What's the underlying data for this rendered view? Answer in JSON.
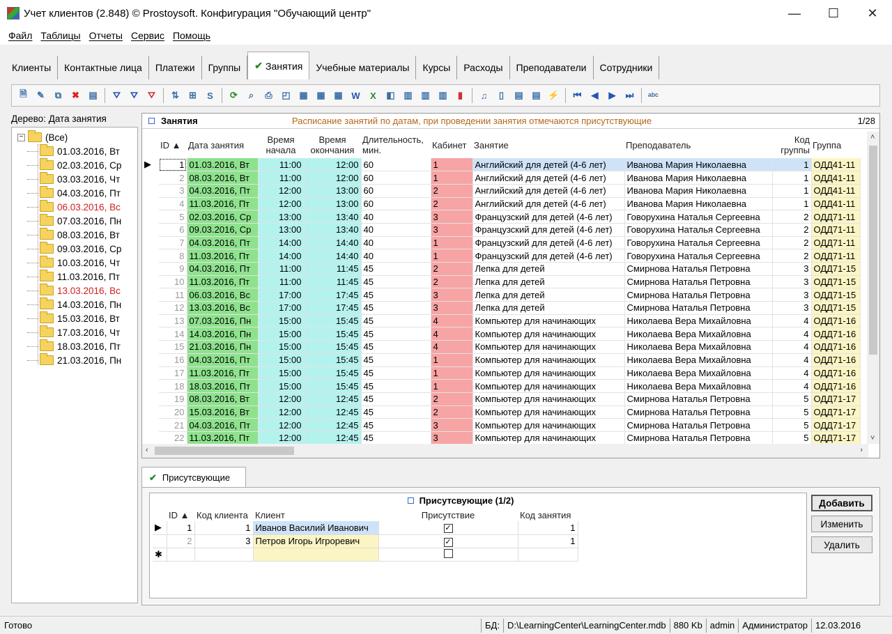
{
  "window": {
    "title": "Учет клиентов (2.848) © Prostoysoft. Конфигурация \"Обучающий центр\"",
    "minimize": "—",
    "maximize": "☐",
    "close": "✕"
  },
  "menu": [
    "Файл",
    "Таблицы",
    "Отчеты",
    "Сервис",
    "Помощь"
  ],
  "tabs": [
    {
      "label": "Клиенты"
    },
    {
      "label": "Контактные лица"
    },
    {
      "label": "Платежи"
    },
    {
      "label": "Группы"
    },
    {
      "label": "Занятия",
      "active": true
    },
    {
      "label": "Учебные материалы"
    },
    {
      "label": "Курсы"
    },
    {
      "label": "Расходы"
    },
    {
      "label": "Преподаватели"
    },
    {
      "label": "Сотрудники"
    }
  ],
  "tree": {
    "label": "Дерево: Дата занятия",
    "root": "(Все)",
    "items": [
      {
        "label": "01.03.2016, Вт"
      },
      {
        "label": "02.03.2016, Ср"
      },
      {
        "label": "03.03.2016, Чт"
      },
      {
        "label": "04.03.2016, Пт"
      },
      {
        "label": "06.03.2016, Вс",
        "weekend": true
      },
      {
        "label": "07.03.2016, Пн"
      },
      {
        "label": "08.03.2016, Вт"
      },
      {
        "label": "09.03.2016, Ср"
      },
      {
        "label": "10.03.2016, Чт"
      },
      {
        "label": "11.03.2016, Пт"
      },
      {
        "label": "13.03.2016, Вс",
        "weekend": true
      },
      {
        "label": "14.03.2016, Пн"
      },
      {
        "label": "15.03.2016, Вт"
      },
      {
        "label": "17.03.2016, Чт"
      },
      {
        "label": "18.03.2016, Пт"
      },
      {
        "label": "21.03.2016, Пн"
      }
    ]
  },
  "grid": {
    "title": "Занятия",
    "description": "Расписание занятий по датам, при проведении занятия отмечаются присутствующие",
    "count": "1/28",
    "columns": [
      "ID ▲",
      "Дата занятия",
      "Время начала",
      "Время окончания",
      "Длительность, мин.",
      "Кабинет",
      "Занятие",
      "Преподаватель",
      "Код группы",
      "Группа"
    ],
    "rows": [
      [
        "1",
        "01.03.2016, Вт",
        "11:00",
        "12:00",
        "60",
        "1",
        "Английский для детей (4-6 лет)",
        "Иванова Мария Николаевна",
        "1",
        "ОДД41-11"
      ],
      [
        "2",
        "08.03.2016, Вт",
        "11:00",
        "12:00",
        "60",
        "1",
        "Английский для детей (4-6 лет)",
        "Иванова Мария Николаевна",
        "1",
        "ОДД41-11"
      ],
      [
        "3",
        "04.03.2016, Пт",
        "12:00",
        "13:00",
        "60",
        "2",
        "Английский для детей (4-6 лет)",
        "Иванова Мария Николаевна",
        "1",
        "ОДД41-11"
      ],
      [
        "4",
        "11.03.2016, Пт",
        "12:00",
        "13:00",
        "60",
        "2",
        "Английский для детей (4-6 лет)",
        "Иванова Мария Николаевна",
        "1",
        "ОДД41-11"
      ],
      [
        "5",
        "02.03.2016, Ср",
        "13:00",
        "13:40",
        "40",
        "3",
        "Французский для детей (4-6 лет)",
        "Говорухина Наталья Сергеевна",
        "2",
        "ОДД71-11"
      ],
      [
        "6",
        "09.03.2016, Ср",
        "13:00",
        "13:40",
        "40",
        "3",
        "Французский для детей (4-6 лет)",
        "Говорухина Наталья Сергеевна",
        "2",
        "ОДД71-11"
      ],
      [
        "7",
        "04.03.2016, Пт",
        "14:00",
        "14:40",
        "40",
        "1",
        "Французский для детей (4-6 лет)",
        "Говорухина Наталья Сергеевна",
        "2",
        "ОДД71-11"
      ],
      [
        "8",
        "11.03.2016, Пт",
        "14:00",
        "14:40",
        "40",
        "1",
        "Французский для детей (4-6 лет)",
        "Говорухина Наталья Сергеевна",
        "2",
        "ОДД71-11"
      ],
      [
        "9",
        "04.03.2016, Пт",
        "11:00",
        "11:45",
        "45",
        "2",
        "Лепка для детей",
        "Смирнова Наталья Петровна",
        "3",
        "ОДД71-15"
      ],
      [
        "10",
        "11.03.2016, Пт",
        "11:00",
        "11:45",
        "45",
        "2",
        "Лепка для детей",
        "Смирнова Наталья Петровна",
        "3",
        "ОДД71-15"
      ],
      [
        "11",
        "06.03.2016, Вс",
        "17:00",
        "17:45",
        "45",
        "3",
        "Лепка для детей",
        "Смирнова Наталья Петровна",
        "3",
        "ОДД71-15"
      ],
      [
        "12",
        "13.03.2016, Вс",
        "17:00",
        "17:45",
        "45",
        "3",
        "Лепка для детей",
        "Смирнова Наталья Петровна",
        "3",
        "ОДД71-15"
      ],
      [
        "13",
        "07.03.2016, Пн",
        "15:00",
        "15:45",
        "45",
        "4",
        "Компьютер для начинающих",
        "Николаева Вера Михайловна",
        "4",
        "ОДД71-16"
      ],
      [
        "14",
        "14.03.2016, Пн",
        "15:00",
        "15:45",
        "45",
        "4",
        "Компьютер для начинающих",
        "Николаева Вера Михайловна",
        "4",
        "ОДД71-16"
      ],
      [
        "15",
        "21.03.2016, Пн",
        "15:00",
        "15:45",
        "45",
        "4",
        "Компьютер для начинающих",
        "Николаева Вера Михайловна",
        "4",
        "ОДД71-16"
      ],
      [
        "16",
        "04.03.2016, Пт",
        "15:00",
        "15:45",
        "45",
        "1",
        "Компьютер для начинающих",
        "Николаева Вера Михайловна",
        "4",
        "ОДД71-16"
      ],
      [
        "17",
        "11.03.2016, Пт",
        "15:00",
        "15:45",
        "45",
        "1",
        "Компьютер для начинающих",
        "Николаева Вера Михайловна",
        "4",
        "ОДД71-16"
      ],
      [
        "18",
        "18.03.2016, Пт",
        "15:00",
        "15:45",
        "45",
        "1",
        "Компьютер для начинающих",
        "Николаева Вера Михайловна",
        "4",
        "ОДД71-16"
      ],
      [
        "19",
        "08.03.2016, Вт",
        "12:00",
        "12:45",
        "45",
        "2",
        "Компьютер для начинающих",
        "Смирнова Наталья Петровна",
        "5",
        "ОДД71-17"
      ],
      [
        "20",
        "15.03.2016, Вт",
        "12:00",
        "12:45",
        "45",
        "2",
        "Компьютер для начинающих",
        "Смирнова Наталья Петровна",
        "5",
        "ОДД71-17"
      ],
      [
        "21",
        "04.03.2016, Пт",
        "12:00",
        "12:45",
        "45",
        "3",
        "Компьютер для начинающих",
        "Смирнова Наталья Петровна",
        "5",
        "ОДД71-17"
      ],
      [
        "22",
        "11.03.2016, Пт",
        "12:00",
        "12:45",
        "45",
        "3",
        "Компьютер для начинающих",
        "Смирнова Наталья Петровна",
        "5",
        "ОДД71-17"
      ]
    ]
  },
  "sub_tab": "Присутсвующие",
  "sub_grid": {
    "title": "Присутсвующие (1/2)",
    "columns": [
      "ID ▲",
      "Код клиента",
      "Клиент",
      "Присутствие",
      "Код занятия"
    ],
    "rows": [
      [
        "1",
        "1",
        "Иванов Василий Иванович",
        "✓",
        "1"
      ],
      [
        "2",
        "3",
        "Петров Игорь Игроревич",
        "✓",
        "1"
      ]
    ],
    "new_row_marker": "✱"
  },
  "buttons": {
    "add": "Добавить",
    "edit": "Изменить",
    "delete": "Удалить"
  },
  "status": {
    "text": "Готово",
    "db_label": "БД:",
    "db_path": "D:\\LearningCenter\\LearningCenter.mdb",
    "size": "880 Kb",
    "user": "admin",
    "role": "Администратор",
    "date": "12.03.2016"
  },
  "toolbar_icons": [
    "new-record-icon",
    "edit-icon",
    "copy-icon",
    "delete-icon",
    "card-icon",
    "filter-icon",
    "filter-edit-icon",
    "filter-clear-icon",
    "sort-icon",
    "tree-icon",
    "sql-icon",
    "refresh-icon",
    "find-icon",
    "print-icon",
    "preview-icon",
    "export-icon",
    "export2-icon",
    "export3-icon",
    "word-icon",
    "excel-icon",
    "html-icon",
    "report-icon",
    "report2-icon",
    "report3-icon",
    "chart-icon",
    "doc-icon",
    "doc2-icon",
    "form-icon",
    "form2-icon",
    "lightning-icon",
    "first-icon",
    "prev-icon",
    "next-icon",
    "last-icon",
    "spell-icon"
  ],
  "colors": {
    "date_col": "#8ee28e",
    "time_col": "#b4f2ee",
    "room_col": "#f7a4a4",
    "group_col": "#fbf5c4",
    "current_row": "#cfe3f8"
  }
}
